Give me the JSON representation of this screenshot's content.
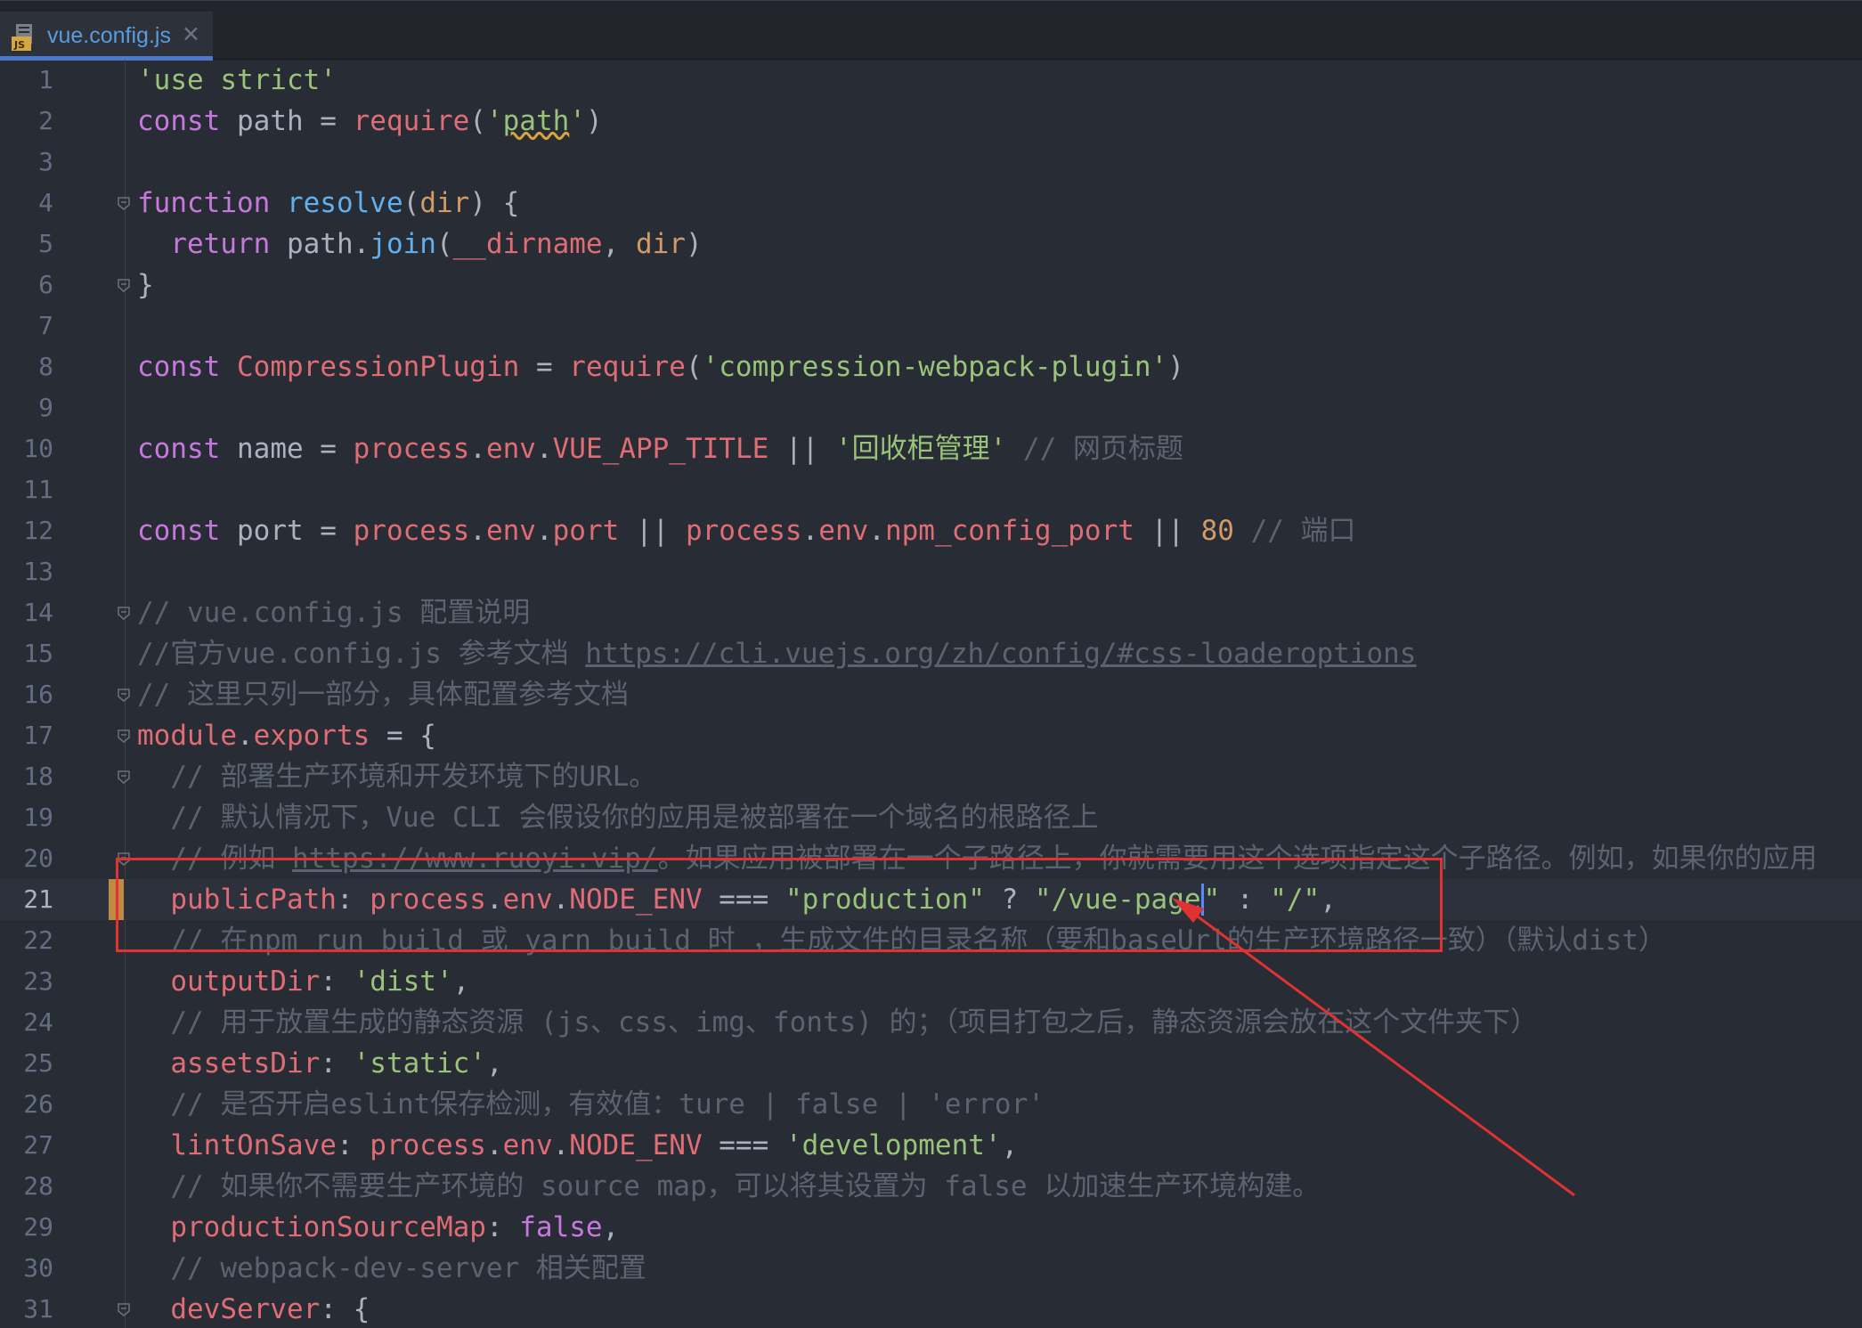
{
  "tab": {
    "file_name": "vue.config.js",
    "close_glyph": "✕",
    "icon": "javascript-file-icon"
  },
  "lines": [
    {
      "n": "1",
      "tokens": [
        {
          "t": "'use strict'",
          "c": "str"
        }
      ]
    },
    {
      "n": "2",
      "tokens": [
        {
          "t": "const",
          "c": "kw"
        },
        {
          "t": " path = ",
          "c": "pl"
        },
        {
          "t": "require",
          "c": "var"
        },
        {
          "t": "(",
          "c": "pl"
        },
        {
          "t": "'",
          "c": "str"
        },
        {
          "t": "path",
          "c": "str wavy"
        },
        {
          "t": "'",
          "c": "str"
        },
        {
          "t": ")",
          "c": "pl"
        }
      ]
    },
    {
      "n": "3",
      "tokens": []
    },
    {
      "n": "4",
      "tokens": [
        {
          "t": "function",
          "c": "kw"
        },
        {
          "t": " ",
          "c": "pl"
        },
        {
          "t": "resolve",
          "c": "fn"
        },
        {
          "t": "(",
          "c": "pl"
        },
        {
          "t": "dir",
          "c": "num"
        },
        {
          "t": ") {",
          "c": "pl"
        }
      ]
    },
    {
      "n": "5",
      "tokens": [
        {
          "t": "  ",
          "c": "pl"
        },
        {
          "t": "return",
          "c": "kw"
        },
        {
          "t": " path.",
          "c": "pl"
        },
        {
          "t": "join",
          "c": "fn"
        },
        {
          "t": "(",
          "c": "pl"
        },
        {
          "t": "__dirname",
          "c": "var"
        },
        {
          "t": ", ",
          "c": "pl"
        },
        {
          "t": "dir",
          "c": "num"
        },
        {
          "t": ")",
          "c": "pl"
        }
      ]
    },
    {
      "n": "6",
      "tokens": [
        {
          "t": "}",
          "c": "pl"
        }
      ]
    },
    {
      "n": "7",
      "tokens": []
    },
    {
      "n": "8",
      "tokens": [
        {
          "t": "const",
          "c": "kw"
        },
        {
          "t": " ",
          "c": "pl"
        },
        {
          "t": "CompressionPlugin",
          "c": "var"
        },
        {
          "t": " = ",
          "c": "pl"
        },
        {
          "t": "require",
          "c": "var"
        },
        {
          "t": "(",
          "c": "pl"
        },
        {
          "t": "'compression-webpack-plugin'",
          "c": "str"
        },
        {
          "t": ")",
          "c": "pl"
        }
      ]
    },
    {
      "n": "9",
      "tokens": []
    },
    {
      "n": "10",
      "tokens": [
        {
          "t": "const",
          "c": "kw"
        },
        {
          "t": " name = ",
          "c": "pl"
        },
        {
          "t": "process",
          "c": "var"
        },
        {
          "t": ".",
          "c": "pl"
        },
        {
          "t": "env",
          "c": "var"
        },
        {
          "t": ".",
          "c": "pl"
        },
        {
          "t": "VUE_APP_TITLE",
          "c": "var"
        },
        {
          "t": " || ",
          "c": "pl"
        },
        {
          "t": "'回收柜管理'",
          "c": "str"
        },
        {
          "t": " // 网页标题",
          "c": "cmt"
        }
      ]
    },
    {
      "n": "11",
      "tokens": []
    },
    {
      "n": "12",
      "tokens": [
        {
          "t": "const",
          "c": "kw"
        },
        {
          "t": " port = ",
          "c": "pl"
        },
        {
          "t": "process",
          "c": "var"
        },
        {
          "t": ".",
          "c": "pl"
        },
        {
          "t": "env",
          "c": "var"
        },
        {
          "t": ".",
          "c": "pl"
        },
        {
          "t": "port",
          "c": "var"
        },
        {
          "t": " || ",
          "c": "pl"
        },
        {
          "t": "process",
          "c": "var"
        },
        {
          "t": ".",
          "c": "pl"
        },
        {
          "t": "env",
          "c": "var"
        },
        {
          "t": ".",
          "c": "pl"
        },
        {
          "t": "npm_config_port",
          "c": "var"
        },
        {
          "t": " || ",
          "c": "pl"
        },
        {
          "t": "80",
          "c": "num"
        },
        {
          "t": " // 端口",
          "c": "cmt"
        }
      ]
    },
    {
      "n": "13",
      "tokens": []
    },
    {
      "n": "14",
      "tokens": [
        {
          "t": "// vue.config.js 配置说明",
          "c": "cmt"
        }
      ]
    },
    {
      "n": "15",
      "tokens": [
        {
          "t": "//官方vue.config.js 参考文档 ",
          "c": "cmt"
        },
        {
          "t": "https://cli.vuejs.org/zh/config/#css-loaderoptions",
          "c": "cmt ul"
        }
      ]
    },
    {
      "n": "16",
      "tokens": [
        {
          "t": "// 这里只列一部分，具体配置参考文档",
          "c": "cmt"
        }
      ]
    },
    {
      "n": "17",
      "tokens": [
        {
          "t": "module",
          "c": "var"
        },
        {
          "t": ".",
          "c": "pl"
        },
        {
          "t": "exports",
          "c": "var"
        },
        {
          "t": " = {",
          "c": "pl"
        }
      ]
    },
    {
      "n": "18",
      "tokens": [
        {
          "t": "  // 部署生产环境和开发环境下的URL。",
          "c": "cmt"
        }
      ]
    },
    {
      "n": "19",
      "tokens": [
        {
          "t": "  // 默认情况下，Vue CLI 会假设你的应用是被部署在一个域名的根路径上",
          "c": "cmt"
        }
      ]
    },
    {
      "n": "20",
      "tokens": [
        {
          "t": "  // 例如 ",
          "c": "cmt"
        },
        {
          "t": "https://www.ruoyi.vip/",
          "c": "cmt ul"
        },
        {
          "t": "。如果应用被部署在一个子路径上，你就需要用这个选项指定这个子路径。例如，如果你的应用",
          "c": "cmt"
        }
      ]
    },
    {
      "n": "21",
      "current": true,
      "tokens": [
        {
          "t": "  ",
          "c": "pl"
        },
        {
          "t": "publicPath",
          "c": "var"
        },
        {
          "t": ": ",
          "c": "pl"
        },
        {
          "t": "process",
          "c": "var"
        },
        {
          "t": ".",
          "c": "pl"
        },
        {
          "t": "env",
          "c": "var"
        },
        {
          "t": ".",
          "c": "pl"
        },
        {
          "t": "NODE_ENV",
          "c": "var"
        },
        {
          "t": " === ",
          "c": "pl"
        },
        {
          "t": "\"production\"",
          "c": "str"
        },
        {
          "t": " ? ",
          "c": "pl"
        },
        {
          "t": "\"/vue-page",
          "c": "str"
        },
        {
          "t": "\"",
          "c": "str caret"
        },
        {
          "t": " : ",
          "c": "pl"
        },
        {
          "t": "\"/\"",
          "c": "str"
        },
        {
          "t": ",",
          "c": "pl"
        }
      ]
    },
    {
      "n": "22",
      "tokens": [
        {
          "t": "  // 在npm run build 或 yarn build 时 ，生成文件的目录名称（要和baseUrl的生产环境路径一致）（默认dist）",
          "c": "cmt"
        }
      ]
    },
    {
      "n": "23",
      "tokens": [
        {
          "t": "  ",
          "c": "pl"
        },
        {
          "t": "outputDir",
          "c": "var"
        },
        {
          "t": ": ",
          "c": "pl"
        },
        {
          "t": "'dist'",
          "c": "str"
        },
        {
          "t": ",",
          "c": "pl"
        }
      ]
    },
    {
      "n": "24",
      "tokens": [
        {
          "t": "  // 用于放置生成的静态资源 (js、css、img、fonts) 的；（项目打包之后，静态资源会放在这个文件夹下）",
          "c": "cmt"
        }
      ]
    },
    {
      "n": "25",
      "tokens": [
        {
          "t": "  ",
          "c": "pl"
        },
        {
          "t": "assetsDir",
          "c": "var"
        },
        {
          "t": ": ",
          "c": "pl"
        },
        {
          "t": "'static'",
          "c": "str"
        },
        {
          "t": ",",
          "c": "pl"
        }
      ]
    },
    {
      "n": "26",
      "tokens": [
        {
          "t": "  // 是否开启eslint保存检测，有效值：ture | false | 'error'",
          "c": "cmt"
        }
      ]
    },
    {
      "n": "27",
      "tokens": [
        {
          "t": "  ",
          "c": "pl"
        },
        {
          "t": "lintOnSave",
          "c": "var"
        },
        {
          "t": ": ",
          "c": "pl"
        },
        {
          "t": "process",
          "c": "var"
        },
        {
          "t": ".",
          "c": "pl"
        },
        {
          "t": "env",
          "c": "var"
        },
        {
          "t": ".",
          "c": "pl"
        },
        {
          "t": "NODE_ENV",
          "c": "var"
        },
        {
          "t": " === ",
          "c": "pl"
        },
        {
          "t": "'development'",
          "c": "str"
        },
        {
          "t": ",",
          "c": "pl"
        }
      ]
    },
    {
      "n": "28",
      "tokens": [
        {
          "t": "  // 如果你不需要生产环境的 source map，可以将其设置为 false 以加速生产环境构建。",
          "c": "cmt"
        }
      ]
    },
    {
      "n": "29",
      "tokens": [
        {
          "t": "  ",
          "c": "pl"
        },
        {
          "t": "productionSourceMap",
          "c": "var"
        },
        {
          "t": ": ",
          "c": "pl"
        },
        {
          "t": "false",
          "c": "kw"
        },
        {
          "t": ",",
          "c": "pl"
        }
      ]
    },
    {
      "n": "30",
      "tokens": [
        {
          "t": "  // webpack-dev-server 相关配置",
          "c": "cmt"
        }
      ]
    },
    {
      "n": "31",
      "tokens": [
        {
          "t": "  ",
          "c": "pl"
        },
        {
          "t": "devServer",
          "c": "var"
        },
        {
          "t": ": {",
          "c": "pl"
        }
      ]
    }
  ],
  "fold_markers": [
    "4",
    "6",
    "14",
    "16",
    "17",
    "18",
    "20",
    "31"
  ],
  "change_marker_line": "21",
  "annotation": {
    "box_color": "#e03232",
    "arrow_color": "#e03232"
  },
  "colors": {
    "background": "#282c34",
    "tabbar": "#21252b",
    "tab_accent": "#4d78cc",
    "keyword": "#c678dd",
    "function": "#61afef",
    "string": "#98c379",
    "variable": "#e06c75",
    "number": "#d19a66",
    "comment": "#5c6370"
  }
}
